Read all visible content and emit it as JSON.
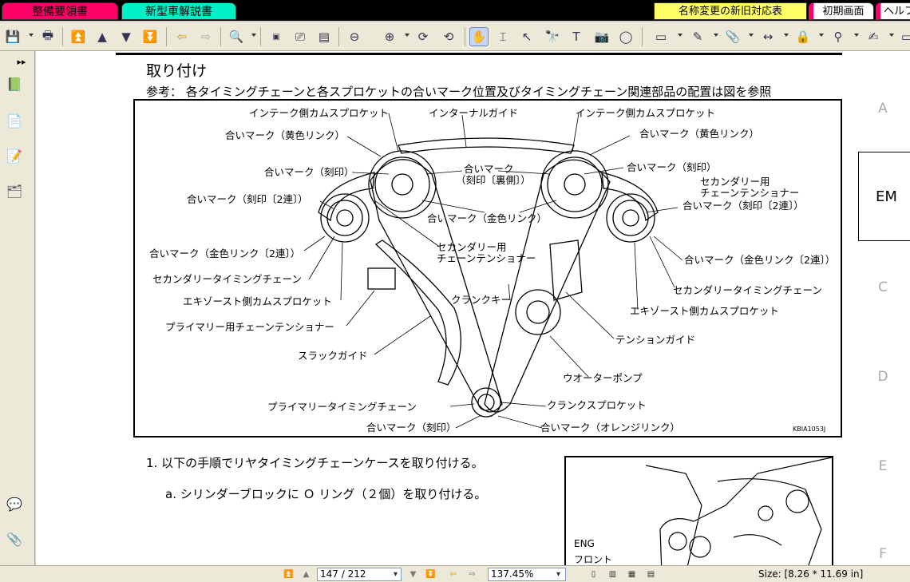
{
  "tabs": {
    "manual": "整備要領書",
    "newcar": "新型車解説書",
    "names": "名称変更の新旧対応表",
    "initial": "初期画面",
    "help": "ヘルフ"
  },
  "toolbar": {
    "icons": [
      "save-icon",
      "print-icon",
      "first-page-icon",
      "prev-page-icon",
      "next-page-icon",
      "last-page-icon",
      "back-icon",
      "forward-icon",
      "zoom-in-icon",
      "actual-size-icon",
      "fit-page-icon",
      "fit-width-icon",
      "zoom-out-icon",
      "zoom-plus-icon",
      "rotate-icon",
      "hand-icon",
      "text-select-icon",
      "select-icon",
      "find-icon",
      "text-tool-icon",
      "snapshot-icon",
      "loupe-icon",
      "comment-icon",
      "note-icon",
      "attach-icon",
      "measure-icon",
      "lock-icon",
      "stamp-icon",
      "sign-icon"
    ]
  },
  "document": {
    "heading": "取り付け",
    "note": "参考： 各タイミングチェーンと各スプロケットの合いマーク位置及びタイミングチェーン関連部品の配置は図を参照",
    "figure_code": "KBIA1053J",
    "figure_labels": {
      "intake_cam_sprocket_l": "インテーク側カムスプロケット",
      "internal_guide": "インターナルガイド",
      "intake_cam_sprocket_r": "インテーク側カムスプロケット",
      "mark_yellow_l": "合いマーク（黄色リンク）",
      "mark_yellow_r": "合いマーク（黄色リンク）",
      "mark_stamp_l": "合いマーク（刻印）",
      "mark_stamp_back_1": "合いマーク",
      "mark_stamp_back_2": "（刻印〔裏側〕）",
      "mark_stamp_r": "合いマーク（刻印）",
      "secondary_tensioner_r_1": "セカンダリー用",
      "secondary_tensioner_r_2": "チェーンテンショナー",
      "mark_stamp_2_l": "合いマーク（刻印〔2連〕）",
      "mark_stamp_2_r": "合いマーク（刻印〔2連〕）",
      "mark_gold": "合いマーク（金色リンク）",
      "mark_gold_2_l": "合いマーク（金色リンク〔2連〕）",
      "mark_gold_2_r": "合いマーク（金色リンク〔2連〕）",
      "secondary_tensioner_c_1": "セカンダリー用",
      "secondary_tensioner_c_2": "チェーンテンショナー",
      "secondary_chain_l": "セカンダリータイミングチェーン",
      "secondary_chain_r": "セカンダリータイミングチェーン",
      "exhaust_cam_l": "エキゾースト側カムスプロケット",
      "exhaust_cam_r": "エキゾースト側カムスプロケット",
      "crank_key": "クランクキー",
      "primary_tensioner": "プライマリー用チェーンテンショナー",
      "tension_guide": "テンションガイド",
      "slack_guide": "スラックガイド",
      "water_pump": "ウオーターポンプ",
      "primary_chain": "プライマリータイミングチェーン",
      "crank_sprocket": "クランクスプロケット",
      "mark_stamp_bottom": "合いマーク（刻印）",
      "mark_orange": "合いマーク（オレンジリンク）"
    },
    "step1": "1.  以下の手順でリヤタイミングチェーンケースを取り付ける。",
    "step1a": "a.  シリンダーブロックに Ｏ リング（２個）を取り付ける。",
    "fig2_labels": {
      "eng": "ENG",
      "front": "フロント"
    }
  },
  "right_index": [
    "A",
    "EM",
    "C",
    "D",
    "E",
    "F"
  ],
  "statusbar": {
    "page": "147 / 212",
    "zoom": "137.45%",
    "size": "Size: [8.26 * 11.69 in]"
  }
}
